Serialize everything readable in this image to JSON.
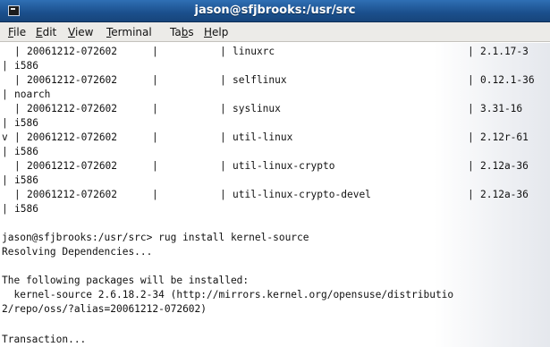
{
  "window": {
    "title": "jason@sfjbrooks:/usr/src"
  },
  "menu": [
    {
      "pre": "",
      "key": "F",
      "post": "ile"
    },
    {
      "pre": "",
      "key": "E",
      "post": "dit"
    },
    {
      "pre": "",
      "key": "V",
      "post": "iew"
    },
    {
      "pre": "",
      "key": "T",
      "post": "erminal"
    },
    {
      "pre": "Ta",
      "key": "b",
      "post": "s"
    },
    {
      "pre": "",
      "key": "H",
      "post": "elp"
    }
  ],
  "table": {
    "rows": [
      {
        "status": "",
        "repo": "20061212-072602",
        "name": "linuxrc",
        "version": "2.1.17-3",
        "arch": "i586"
      },
      {
        "status": "",
        "repo": "20061212-072602",
        "name": "selflinux",
        "version": "0.12.1-36",
        "arch": "noarch"
      },
      {
        "status": "",
        "repo": "20061212-072602",
        "name": "syslinux",
        "version": "3.31-16",
        "arch": "i586"
      },
      {
        "status": "v",
        "repo": "20061212-072602",
        "name": "util-linux",
        "version": "2.12r-61",
        "arch": "i586"
      },
      {
        "status": "",
        "repo": "20061212-072602",
        "name": "util-linux-crypto",
        "version": "2.12a-36",
        "arch": "i586"
      },
      {
        "status": "",
        "repo": "20061212-072602",
        "name": "util-linux-crypto-devel",
        "version": "2.12a-36",
        "arch": "i586"
      }
    ]
  },
  "session": {
    "prompt_line": "jason@sfjbrooks:/usr/src> rug install kernel-source",
    "resolving": "Resolving Dependencies...",
    "following": "The following packages will be installed:",
    "pkg_line1": "  kernel-source 2.6.18.2-34 (http://mirrors.kernel.org/opensuse/distributio",
    "pkg_line2": "2/repo/oss/?alias=20061212-072602)",
    "transaction": "Transaction..."
  }
}
